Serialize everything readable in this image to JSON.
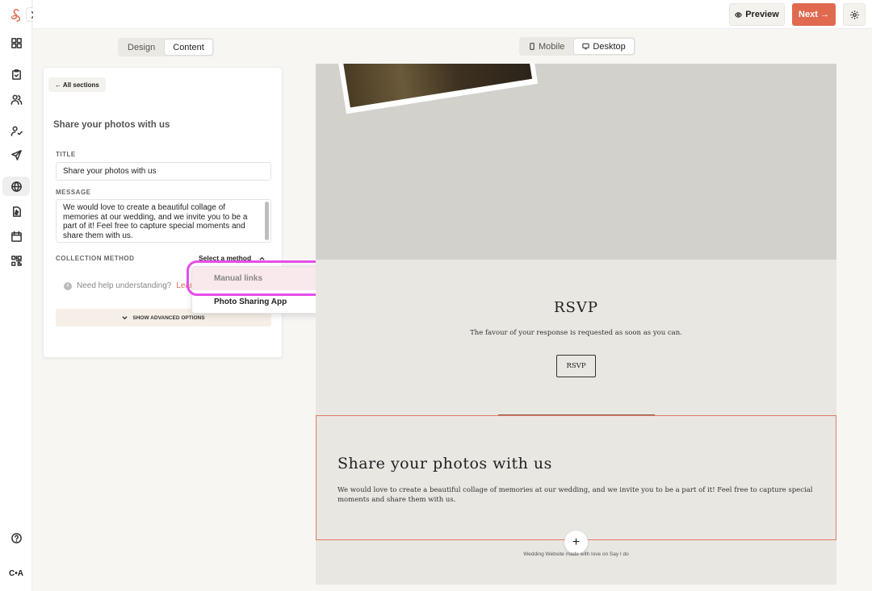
{
  "topbar": {
    "preview_label": "Preview",
    "next_label": "Next →"
  },
  "rail": {
    "avatar_initials": "C•A"
  },
  "mode_toggle": {
    "design_label": "Design",
    "content_label": "Content",
    "selected": "Content"
  },
  "device_toggle": {
    "mobile_label": "Mobile",
    "desktop_label": "Desktop",
    "selected": "Desktop"
  },
  "editor": {
    "back_label": "← All sections",
    "section_title": "Share your photos with us",
    "title_label": "TITLE",
    "title_value": "Share your photos with us",
    "message_label": "MESSAGE",
    "message_value": "We would love to create a beautiful collage of memories at our wedding, and we invite you to be a part of it! Feel free to capture special moments and share them with us.",
    "collection_label": "COLLECTION METHOD",
    "collection_select_label": "Select a method",
    "help_text": "Need help understanding?",
    "help_link": "Learn",
    "advanced_label": "SHOW ADVANCED OPTIONS"
  },
  "dropdown": {
    "options": [
      "Manual links",
      "Photo Sharing App"
    ],
    "highlighted": "Manual links"
  },
  "preview": {
    "rsvp_title": "RSVP",
    "rsvp_text": "The favour of your response is requested as soon as you can.",
    "rsvp_button": "RSVP",
    "share_title": "Share your photos with us",
    "share_message": "We would love to create a beautiful collage of memories at our wedding, and we invite you to be a part of it! Feel free to capture special moments and share them with us.",
    "add_label": "+",
    "footer": "Wedding Website made with love on Say I do"
  },
  "colors": {
    "accent": "#e06a50",
    "highlight_ring": "#e64de8",
    "section_border": "#e07a63"
  }
}
